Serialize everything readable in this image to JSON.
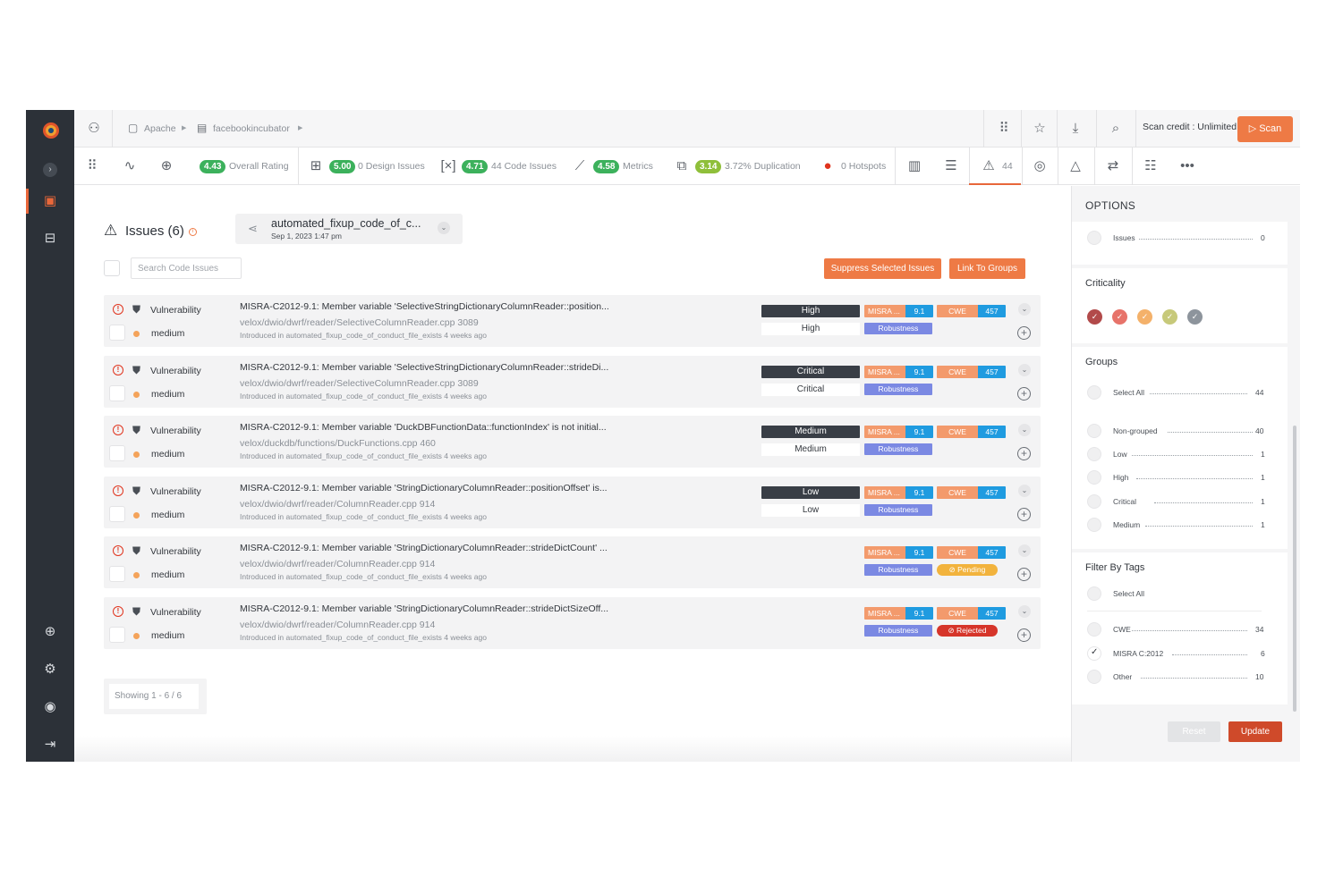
{
  "topbar": {
    "breadcrumb": [
      "Apache",
      "facebookincubator"
    ],
    "scan_credit": "Scan credit : Unlimited",
    "scan_label": "Scan"
  },
  "metrics": {
    "overall": {
      "score": "4.43",
      "label": "Overall Rating"
    },
    "design": {
      "score": "5.00",
      "label": "0 Design Issues"
    },
    "code": {
      "score": "4.71",
      "label": "44 Code Issues"
    },
    "metrics": {
      "score": "4.58",
      "label": "Metrics"
    },
    "duplication": {
      "score": "3.14",
      "label": "3.72% Duplication"
    },
    "hotspots": {
      "label": "0 Hotspots"
    },
    "issues_count": "44"
  },
  "issues": {
    "title": "Issues (6)",
    "branch_name": "automated_fixup_code_of_c...",
    "branch_date": "Sep 1, 2023    1:47 pm",
    "search_placeholder": "Search Code Issues",
    "suppress_label": "Suppress Selected Issues",
    "link_label": "Link To Groups",
    "showing": "Showing    1 - 6 / 6",
    "rows": [
      {
        "category": "Vulnerability",
        "severity": "medium",
        "title": "MISRA-C2012-9.1: Member variable 'SelectiveStringDictionaryColumnReader::position...",
        "file": "velox/dwio/dwrf/reader/SelectiveColumnReader.cpp  3089",
        "introduced": "Introduced in automated_fixup_code_of_conduct_file_exists 4 weeks ago",
        "crit_dark": "High",
        "crit_light": "High",
        "misra": "MISRA ...",
        "misra_num": "9.1",
        "cwe": "CWE",
        "cwe_num": "457",
        "robustness": "Robustness",
        "status": ""
      },
      {
        "category": "Vulnerability",
        "severity": "medium",
        "title": "MISRA-C2012-9.1: Member variable 'SelectiveStringDictionaryColumnReader::strideDi...",
        "file": "velox/dwio/dwrf/reader/SelectiveColumnReader.cpp  3089",
        "introduced": "Introduced in automated_fixup_code_of_conduct_file_exists 4 weeks ago",
        "crit_dark": "Critical",
        "crit_light": "Critical",
        "misra": "MISRA ...",
        "misra_num": "9.1",
        "cwe": "CWE",
        "cwe_num": "457",
        "robustness": "Robustness",
        "status": ""
      },
      {
        "category": "Vulnerability",
        "severity": "medium",
        "title": "MISRA-C2012-9.1: Member variable 'DuckDBFunctionData::functionIndex' is not initial...",
        "file": "velox/duckdb/functions/DuckFunctions.cpp  460",
        "introduced": "Introduced in automated_fixup_code_of_conduct_file_exists 4 weeks ago",
        "crit_dark": "Medium",
        "crit_light": "Medium",
        "misra": "MISRA ...",
        "misra_num": "9.1",
        "cwe": "CWE",
        "cwe_num": "457",
        "robustness": "Robustness",
        "status": ""
      },
      {
        "category": "Vulnerability",
        "severity": "medium",
        "title": "MISRA-C2012-9.1: Member variable 'StringDictionaryColumnReader::positionOffset' is...",
        "file": "velox/dwio/dwrf/reader/ColumnReader.cpp  914",
        "introduced": "Introduced in automated_fixup_code_of_conduct_file_exists 4 weeks ago",
        "crit_dark": "Low",
        "crit_light": "Low",
        "misra": "MISRA ...",
        "misra_num": "9.1",
        "cwe": "CWE",
        "cwe_num": "457",
        "robustness": "Robustness",
        "status": ""
      },
      {
        "category": "Vulnerability",
        "severity": "medium",
        "title": "MISRA-C2012-9.1: Member variable 'StringDictionaryColumnReader::strideDictCount' ...",
        "file": "velox/dwio/dwrf/reader/ColumnReader.cpp  914",
        "introduced": "Introduced in automated_fixup_code_of_conduct_file_exists 4 weeks ago",
        "crit_dark": "",
        "crit_light": "",
        "misra": "MISRA ...",
        "misra_num": "9.1",
        "cwe": "CWE",
        "cwe_num": "457",
        "robustness": "Robustness",
        "status": "Pending"
      },
      {
        "category": "Vulnerability",
        "severity": "medium",
        "title": "MISRA-C2012-9.1: Member variable 'StringDictionaryColumnReader::strideDictSizeOff...",
        "file": "velox/dwio/dwrf/reader/ColumnReader.cpp  914",
        "introduced": "Introduced in automated_fixup_code_of_conduct_file_exists 4 weeks ago",
        "crit_dark": "",
        "crit_light": "",
        "misra": "MISRA ...",
        "misra_num": "9.1",
        "cwe": "CWE",
        "cwe_num": "457",
        "robustness": "Robustness",
        "status": "Rejected"
      }
    ]
  },
  "options": {
    "head": "OPTIONS",
    "issues_label": "Issues",
    "issues_count": "0",
    "criticality_title": "Criticality",
    "criticality_colors": [
      "#b24a4a",
      "#e7736a",
      "#f4b16a",
      "#c7c97a",
      "#8d949c"
    ],
    "groups_title": "Groups",
    "groups_select_all": "Select All",
    "groups_select_all_count": "44",
    "groups": [
      {
        "label": "Non-grouped",
        "count": "40"
      },
      {
        "label": "Low",
        "count": "1"
      },
      {
        "label": "High",
        "count": "1"
      },
      {
        "label": "Critical",
        "count": "1"
      },
      {
        "label": "Medium",
        "count": "1"
      }
    ],
    "tags_title": "Filter By Tags",
    "tags_select_all": "Select All",
    "tags": [
      {
        "label": "CWE",
        "count": "34",
        "checked": false
      },
      {
        "label": "MISRA C:2012",
        "count": "6",
        "checked": true
      },
      {
        "label": "Other",
        "count": "10",
        "checked": false
      }
    ],
    "reset_label": "Reset",
    "update_label": "Update"
  }
}
